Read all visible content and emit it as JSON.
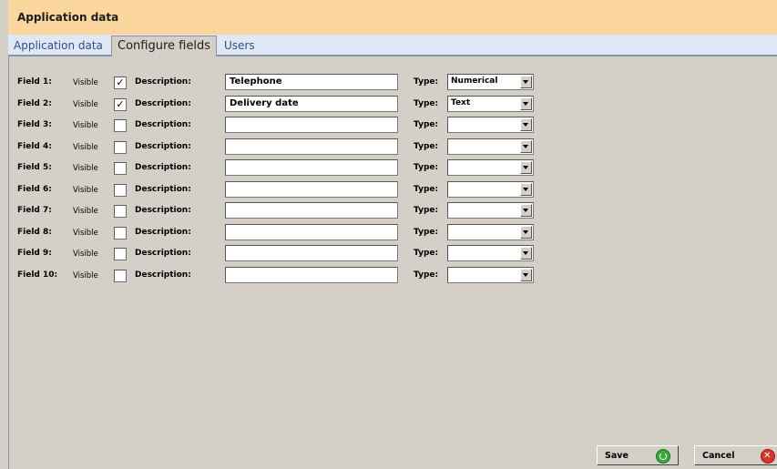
{
  "window": {
    "title": "Application data"
  },
  "tabs": [
    {
      "label": "Application data"
    },
    {
      "label": "Configure fields",
      "selected": true
    },
    {
      "label": "Users"
    }
  ],
  "labels": {
    "visible": "Visible",
    "description": "Description:",
    "type": "Type:"
  },
  "fields": [
    {
      "label": "Field 1:",
      "visible": true,
      "description": "Telephone",
      "type": "Numerical"
    },
    {
      "label": "Field 2:",
      "visible": true,
      "description": "Delivery date",
      "type": "Text"
    },
    {
      "label": "Field 3:",
      "visible": false,
      "description": "",
      "type": ""
    },
    {
      "label": "Field 4:",
      "visible": false,
      "description": "",
      "type": ""
    },
    {
      "label": "Field 5:",
      "visible": false,
      "description": "",
      "type": ""
    },
    {
      "label": "Field 6:",
      "visible": false,
      "description": "",
      "type": ""
    },
    {
      "label": "Field 7:",
      "visible": false,
      "description": "",
      "type": ""
    },
    {
      "label": "Field 8:",
      "visible": false,
      "description": "",
      "type": ""
    },
    {
      "label": "Field 9:",
      "visible": false,
      "description": "",
      "type": ""
    },
    {
      "label": "Field 10:",
      "visible": false,
      "description": "",
      "type": ""
    }
  ],
  "buttons": {
    "save": "Save",
    "cancel": "Cancel",
    "save_icon": "refresh-icon",
    "cancel_icon": "close-icon"
  },
  "colors": {
    "title_bar": "#fbd69e",
    "tab_bar": "#dfe8f4",
    "tab_text": "#2d4f87",
    "save_icon": "#3aa83a",
    "cancel_icon": "#d9342b"
  }
}
